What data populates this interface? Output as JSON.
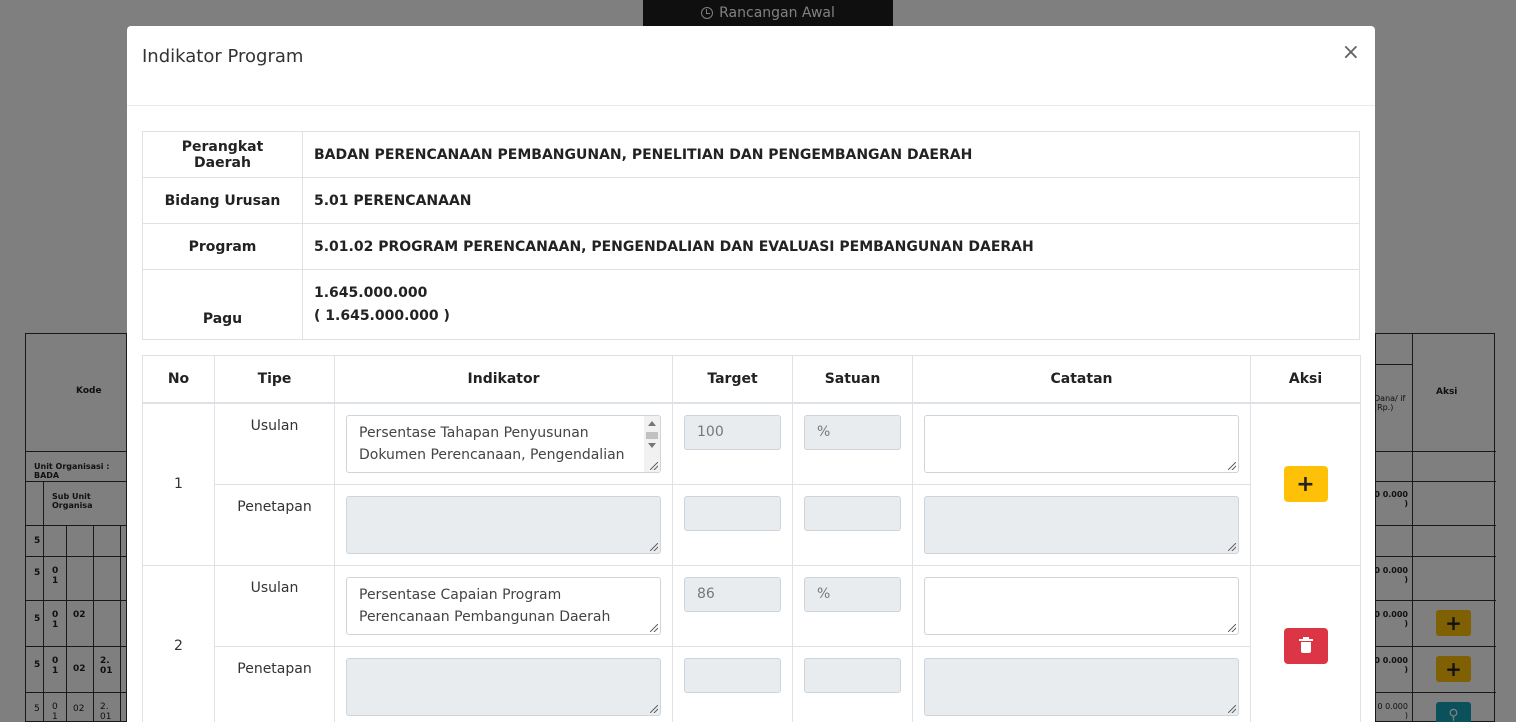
{
  "background": {
    "tab_label": "Rancangan Awal",
    "left_table": {
      "header": "Kode",
      "unit_org": "Unit Organisasi : BADA",
      "sub_unit": "Sub Unit Organisa",
      "rows": [
        [
          "5",
          "",
          "",
          ""
        ],
        [
          "5",
          "0 1",
          "",
          ""
        ],
        [
          "5",
          "0 1",
          "02",
          ""
        ],
        [
          "5",
          "0 1",
          "02",
          "2. 01"
        ],
        [
          "5",
          "0 1",
          "02",
          "2. 01"
        ]
      ]
    },
    "right_table": {
      "col1_header": "Dana/ if (Rp.)",
      "col2_header": "Aksi",
      "values": [
        "0 0.000 )",
        "0 0.000 )",
        "0 0.000 )",
        "0 0.000 )",
        "0 0.000 )"
      ]
    }
  },
  "modal": {
    "title": "Indikator Program",
    "close_symbol": "×",
    "info": {
      "perangkat_daerah_label": "Perangkat Daerah",
      "perangkat_daerah_value": "BADAN PERENCANAAN PEMBANGUNAN, PENELITIAN DAN PENGEMBANGAN DAERAH",
      "bidang_urusan_label": "Bidang Urusan",
      "bidang_urusan_value": "5.01 PERENCANAAN",
      "program_label": "Program",
      "program_value": "5.01.02 PROGRAM PERENCANAAN, PENGENDALIAN DAN EVALUASI PEMBANGUNAN DAERAH",
      "pagu_label": "Pagu",
      "pagu_value": "1.645.000.000",
      "pagu_value_paren": "( 1.645.000.000 )"
    },
    "table": {
      "headers": [
        "No",
        "Tipe",
        "Indikator",
        "Target",
        "Satuan",
        "Catatan",
        "Aksi"
      ],
      "rows": [
        {
          "no": "1",
          "usulan_label": "Usulan",
          "usulan_indikator": "Persentase Tahapan Penyusunan Dokumen Perencanaan, Pengendalian",
          "usulan_target": "100",
          "usulan_satuan": "%",
          "usulan_catatan": "",
          "penetapan_label": "Penetapan",
          "penetapan_indikator": "",
          "penetapan_target": "",
          "penetapan_satuan": "",
          "penetapan_catatan": "",
          "action_icon": "plus-icon",
          "action_symbol": "+"
        },
        {
          "no": "2",
          "usulan_label": "Usulan",
          "usulan_indikator": "Persentase Capaian Program Perencanaan Pembangunan Daerah",
          "usulan_target": "86",
          "usulan_satuan": "%",
          "usulan_catatan": "",
          "penetapan_label": "Penetapan",
          "penetapan_indikator": "",
          "penetapan_target": "",
          "penetapan_satuan": "",
          "penetapan_catatan": "",
          "action_icon": "trash-icon"
        }
      ]
    }
  },
  "colors": {
    "add_button": "#ffc107",
    "delete_button": "#dc3545",
    "search_button": "#17a2b8",
    "disabled_field": "#e9ecef"
  }
}
